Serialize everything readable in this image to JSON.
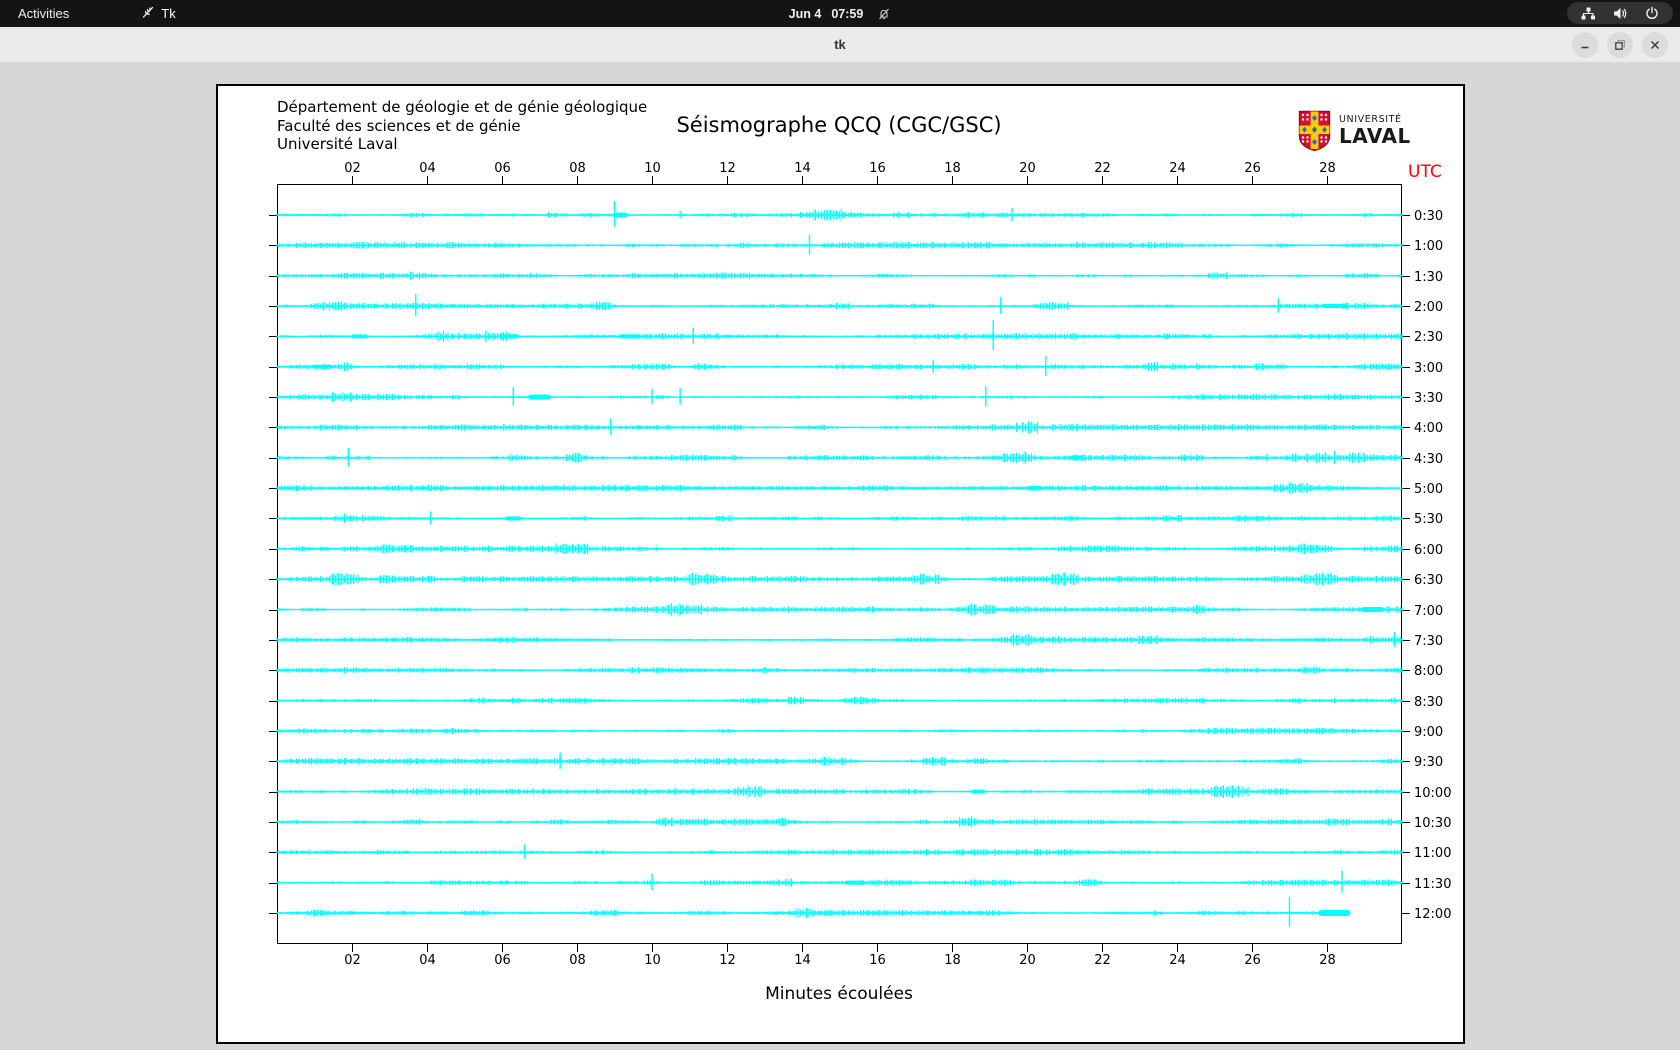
{
  "top_bar": {
    "activities_label": "Activities",
    "app_name": "Tk",
    "clock": {
      "date": "Jun 4",
      "time": "07:59"
    },
    "colors": {
      "bg": "#141414",
      "fg": "#f2f2f2",
      "pill_bg": "#323232"
    }
  },
  "title_bar": {
    "title": "tk",
    "buttons": [
      "minimize",
      "maximize",
      "close"
    ],
    "colors": {
      "bg": "#ebebeb",
      "button_bg": "#dcdcdc"
    }
  },
  "window": {
    "bg": "#d6d6d6"
  },
  "figure": {
    "header_lines": [
      "Département de géologie et de génie géologique",
      "Faculté des sciences et de génie",
      "Université Laval"
    ],
    "title": "Séismographe QCQ (CGC/GSC)",
    "logo": {
      "small_text": "UNIVERSITÉ",
      "large_text": "LAVAL",
      "shield_colors": {
        "red": "#d21034",
        "gold": "#ffcc00",
        "blue": "#2a6db5",
        "white": "#ffffff"
      }
    },
    "utc_label": "UTC",
    "utc_color": "#ff0000",
    "xlabel": "Minutes écoulées",
    "bg": "#ffffff",
    "border_color": "#000000"
  },
  "chart_data": {
    "type": "line",
    "title": "Séismographe QCQ (CGC/GSC)",
    "xlabel": "Minutes écoulées",
    "x_range_minutes": [
      0,
      30
    ],
    "x_ticks": [
      "02",
      "04",
      "06",
      "08",
      "10",
      "12",
      "14",
      "16",
      "18",
      "20",
      "22",
      "24",
      "26",
      "28"
    ],
    "x_tick_minutes": [
      2,
      4,
      6,
      8,
      10,
      12,
      14,
      16,
      18,
      20,
      22,
      24,
      26,
      28
    ],
    "row_interval_minutes": 30,
    "trace_color": "#00ffff",
    "axis_color": "#000000",
    "rows": [
      {
        "label": "0:30",
        "events": [
          {
            "type": "spike",
            "m": 9.0,
            "amp": 14
          },
          {
            "type": "burst",
            "m": 9.15,
            "w": 10,
            "h": 5
          },
          {
            "type": "spike",
            "m": 10.75,
            "amp": 4
          },
          {
            "type": "spike",
            "m": 19.6,
            "amp": 7
          }
        ]
      },
      {
        "label": "1:00",
        "events": [
          {
            "type": "spike",
            "m": 14.2,
            "amp": 11
          }
        ]
      },
      {
        "label": "1:30",
        "events": []
      },
      {
        "label": "2:00",
        "events": [
          {
            "type": "spike",
            "m": 3.7,
            "amp": 12
          },
          {
            "type": "spike",
            "m": 19.3,
            "amp": 9
          },
          {
            "type": "spike",
            "m": 26.7,
            "amp": 8
          },
          {
            "type": "burst",
            "m": 28.2,
            "w": 22,
            "h": 4
          }
        ]
      },
      {
        "label": "2:30",
        "events": [
          {
            "type": "burst",
            "m": 2.2,
            "w": 12,
            "h": 4
          },
          {
            "type": "burst",
            "m": 6.2,
            "w": 14,
            "h": 4
          },
          {
            "type": "burst",
            "m": 9.4,
            "w": 16,
            "h": 4
          },
          {
            "type": "spike",
            "m": 11.1,
            "amp": 9
          },
          {
            "type": "spike",
            "m": 19.1,
            "amp": 16
          }
        ]
      },
      {
        "label": "3:00",
        "events": [
          {
            "type": "burst",
            "m": 1.2,
            "w": 16,
            "h": 4
          },
          {
            "type": "spike",
            "m": 17.5,
            "amp": 7
          },
          {
            "type": "spike",
            "m": 20.5,
            "amp": 11
          }
        ]
      },
      {
        "label": "3:30",
        "events": [
          {
            "type": "spike",
            "m": 6.3,
            "amp": 10
          },
          {
            "type": "burst",
            "m": 7.0,
            "w": 18,
            "h": 5
          },
          {
            "type": "spike",
            "m": 10.0,
            "amp": 8
          },
          {
            "type": "spike",
            "m": 10.75,
            "amp": 9
          },
          {
            "type": "spike",
            "m": 18.9,
            "amp": 11
          }
        ]
      },
      {
        "label": "4:00",
        "events": [
          {
            "type": "spike",
            "m": 8.9,
            "amp": 9
          },
          {
            "type": "spike",
            "m": 21.2,
            "amp": 4
          }
        ]
      },
      {
        "label": "4:30",
        "events": [
          {
            "type": "spike",
            "m": 1.9,
            "amp": 10
          },
          {
            "type": "burst",
            "m": 21.3,
            "w": 10,
            "h": 4
          },
          {
            "type": "spike",
            "m": 26.4,
            "amp": 4
          },
          {
            "type": "spike",
            "m": 28.2,
            "amp": 7
          }
        ]
      },
      {
        "label": "5:00",
        "events": [
          {
            "type": "burst",
            "m": 20.2,
            "w": 12,
            "h": 4
          }
        ]
      },
      {
        "label": "5:30",
        "events": [
          {
            "type": "spike",
            "m": 1.8,
            "amp": 5
          },
          {
            "type": "spike",
            "m": 4.1,
            "amp": 7
          },
          {
            "type": "burst",
            "m": 6.3,
            "w": 12,
            "h": 4
          }
        ]
      },
      {
        "label": "6:00",
        "events": []
      },
      {
        "label": "6:30",
        "events": []
      },
      {
        "label": "7:00",
        "events": [
          {
            "type": "burst",
            "m": 29.2,
            "w": 16,
            "h": 5
          }
        ]
      },
      {
        "label": "7:30",
        "events": [
          {
            "type": "spike",
            "m": 29.8,
            "amp": 8
          }
        ]
      },
      {
        "label": "8:00",
        "events": []
      },
      {
        "label": "8:30",
        "events": []
      },
      {
        "label": "9:00",
        "events": []
      },
      {
        "label": "9:30",
        "events": [
          {
            "type": "spike",
            "m": 7.55,
            "amp": 9
          }
        ]
      },
      {
        "label": "10:00",
        "events": [
          {
            "type": "burst",
            "m": 18.7,
            "w": 10,
            "h": 4
          }
        ]
      },
      {
        "label": "10:30",
        "events": []
      },
      {
        "label": "11:00",
        "events": [
          {
            "type": "spike",
            "m": 6.6,
            "amp": 8
          }
        ]
      },
      {
        "label": "11:30",
        "events": [
          {
            "type": "spike",
            "m": 10.0,
            "amp": 9
          },
          {
            "type": "burst",
            "m": 15.4,
            "w": 14,
            "h": 4
          },
          {
            "type": "spike",
            "m": 28.4,
            "amp": 12
          }
        ]
      },
      {
        "label": "12:00",
        "end_minute": 28.6,
        "events": [
          {
            "type": "spike",
            "m": 27.0,
            "amp": 16
          },
          {
            "type": "burst",
            "m": 28.2,
            "w": 26,
            "h": 6
          }
        ]
      }
    ]
  }
}
